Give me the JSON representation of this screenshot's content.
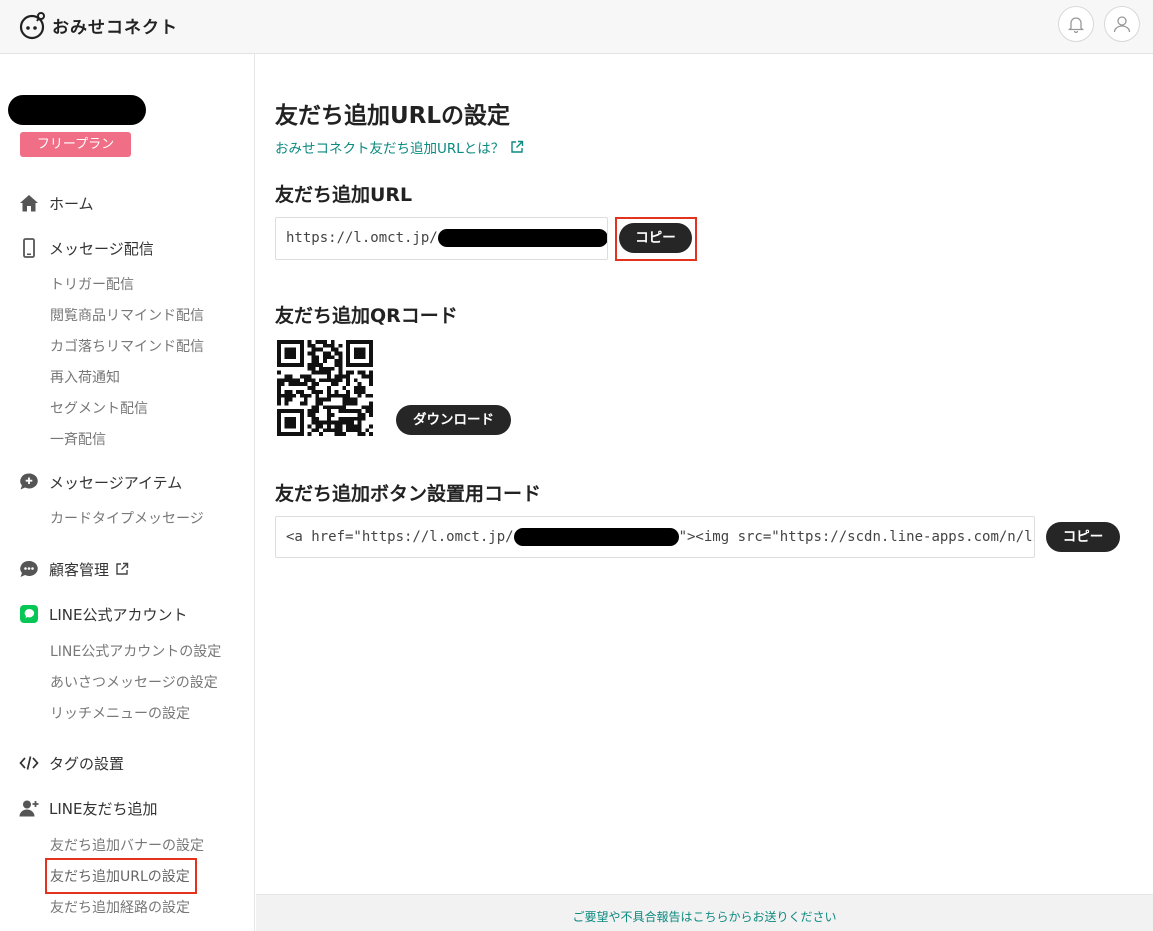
{
  "header": {
    "logo_text": "おみせコネクト",
    "icons": {
      "bell": "bell-icon",
      "user": "user-icon"
    }
  },
  "sidebar": {
    "plan_badge": "フリープラン",
    "home": "ホーム",
    "message_delivery": "メッセージ配信",
    "message_sub": [
      "トリガー配信",
      "閲覧商品リマインド配信",
      "カゴ落ちリマインド配信",
      "再入荷通知",
      "セグメント配信",
      "一斉配信"
    ],
    "message_items": "メッセージアイテム",
    "message_items_sub": [
      "カードタイプメッセージ"
    ],
    "customer_mgmt": "顧客管理",
    "line_account": "LINE公式アカウント",
    "line_account_sub": [
      "LINE公式アカウントの設定",
      "あいさつメッセージの設定",
      "リッチメニューの設定"
    ],
    "tag_setup": "タグの設置",
    "line_friend": "LINE友だち追加",
    "line_friend_sub": [
      "友だち追加バナーの設定",
      "友だち追加URLの設定",
      "友だち追加経路の設定"
    ]
  },
  "main": {
    "title": "友だち追加URLの設定",
    "help_link": "おみせコネクト友だち追加URLとは？",
    "url_section": "友だち追加URL",
    "url_prefix": "https://l.omct.jp/",
    "copy_label": "コピー",
    "qr_section": "友だち追加QRコード",
    "download_label": "ダウンロード",
    "button_code_section": "友だち追加ボタン設置用コード",
    "code_prefix": "<a href=\"https://l.omct.jp/",
    "code_suffix": "\"><img src=\"https://scdn.line-apps.com/n/line_add_friends/btn/ja.png\" alt=\"友だち追加\" height=\"36\" border=\"0\"></a>"
  },
  "footer": {
    "feedback": "ご要望や不具合報告はこちらからお送りください"
  },
  "colors": {
    "accent_teal": "#0c8a80",
    "plan_pink": "#f06f87",
    "highlight_red": "#e3321e",
    "button_dark": "#262626"
  }
}
